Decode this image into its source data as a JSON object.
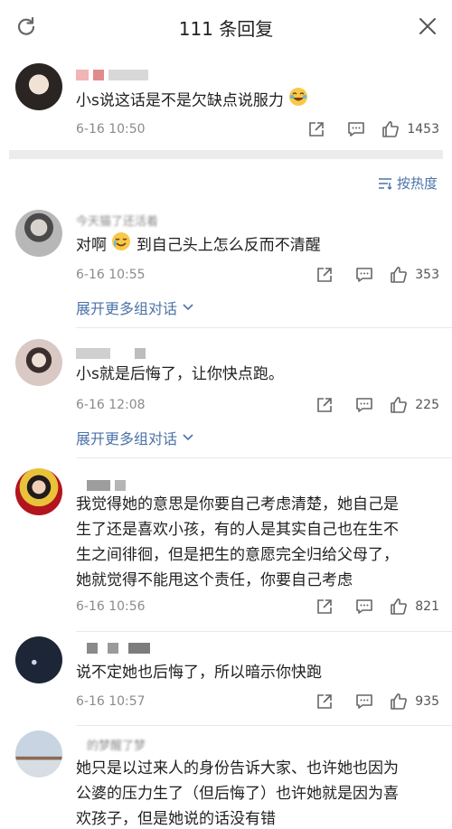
{
  "header": {
    "title": "111 条回复",
    "refresh_icon": "refresh-icon",
    "close_icon": "close-icon"
  },
  "main_comment": {
    "text": "小s说这话是不是欠缺点说服力",
    "time": "6-16 10:50",
    "likes": "1453"
  },
  "sort": {
    "label": "按热度",
    "icon": "sort-icon"
  },
  "replies": [
    {
      "name": "今天猫了还活着",
      "text": "对啊",
      "text_suffix": "到自己头上怎么反而不清醒",
      "time": "6-16 10:55",
      "likes": "353",
      "more": "展开更多组对话"
    },
    {
      "text": "小s就是后悔了，让你快点跑。",
      "time": "6-16 12:08",
      "likes": "225",
      "more": "展开更多组对话"
    },
    {
      "text_lines": [
        "我觉得她的意思是你要自己考虑清楚，她自己是",
        "生了还是喜欢小孩，有的人是其实自己也在生不",
        "生之间徘徊，但是把生的意愿完全归给父母了，",
        "她就觉得不能甩这个责任，你要自己考虑"
      ],
      "time": "6-16 10:56",
      "likes": "821"
    },
    {
      "text": "说不定她也后悔了，所以暗示你快跑",
      "time": "6-16 10:57",
      "likes": "935"
    },
    {
      "name": "的梦醒了梦",
      "text_lines": [
        "她只是以过来人的身份告诉大家、也许她也因为",
        "公婆的压力生了（但后悔了）也许她就是因为喜",
        "欢孩子，但是她说的话没有错"
      ]
    }
  ],
  "colors": {
    "link": "#4b73a8",
    "meta": "#8b8b8b",
    "separator": "#ececec"
  }
}
